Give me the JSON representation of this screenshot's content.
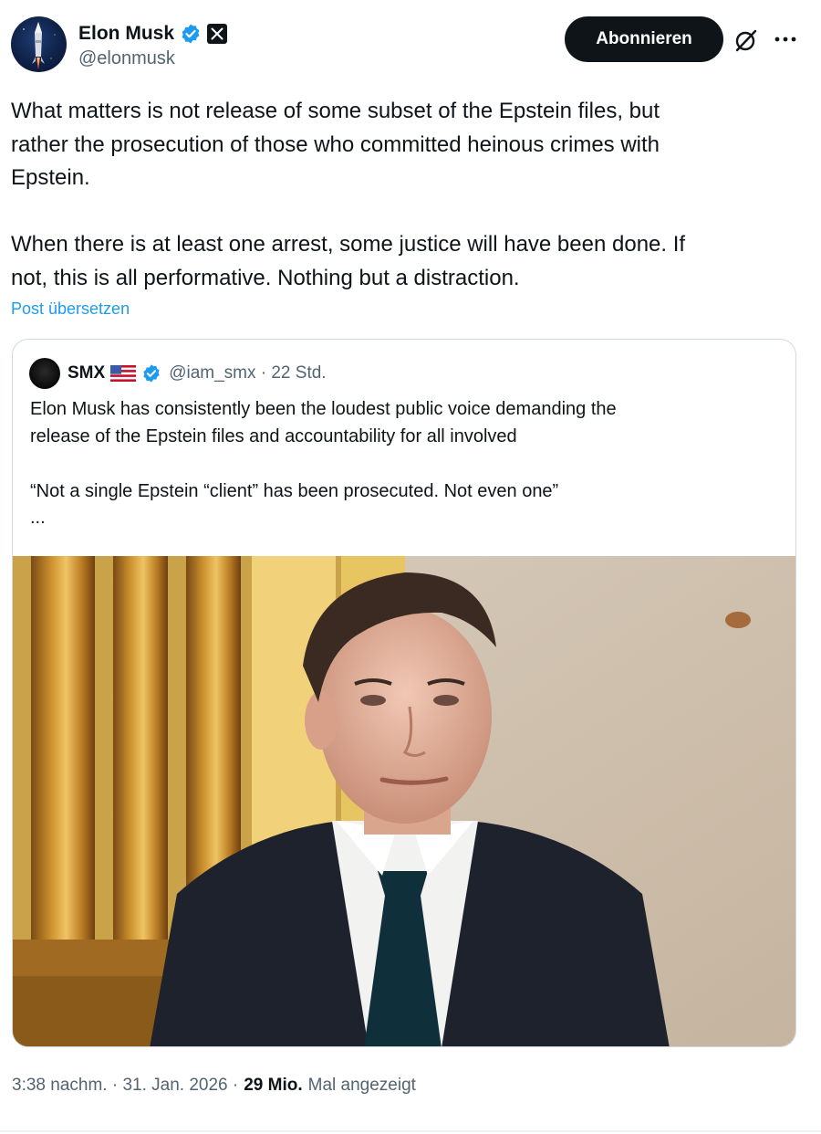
{
  "author": {
    "display_name": "Elon Musk",
    "handle": "@elonmusk",
    "verified_badge_color": "#1d9bf0"
  },
  "actions": {
    "subscribe_label": "Abonnieren",
    "grok_icon": "grok-icon",
    "more_icon": "more-options-icon"
  },
  "tweet": {
    "text": "What matters is not release of some subset of the Epstein files, but\nrather the prosecution of those who committed heinous crimes with\nEpstein.\n\nWhen there is at least one arrest, some justice will have been done. If\nnot, this is all performative. Nothing but a distraction.",
    "translate_label": "Post übersetzen"
  },
  "quote": {
    "display_name": "SMX",
    "flag": "us-flag",
    "handle_time": "@iam_smx · 22 Std.",
    "text": "Elon Musk has consistently been the loudest public voice demanding the\nrelease of the Epstein files and accountability for all involved\n\n“Not a single Epstein “client” has been prosecuted. Not even one”",
    "ellipsis": "..."
  },
  "meta": {
    "timestamp": "3:38 nachm. · 31. Jan. 2026 ·",
    "views_count": "29 Mio.",
    "views_label": "Mal angezeigt"
  },
  "colors": {
    "text_primary": "#0f1419",
    "text_secondary": "#536471",
    "link": "#1d9bf0",
    "border": "#cfd9de"
  }
}
